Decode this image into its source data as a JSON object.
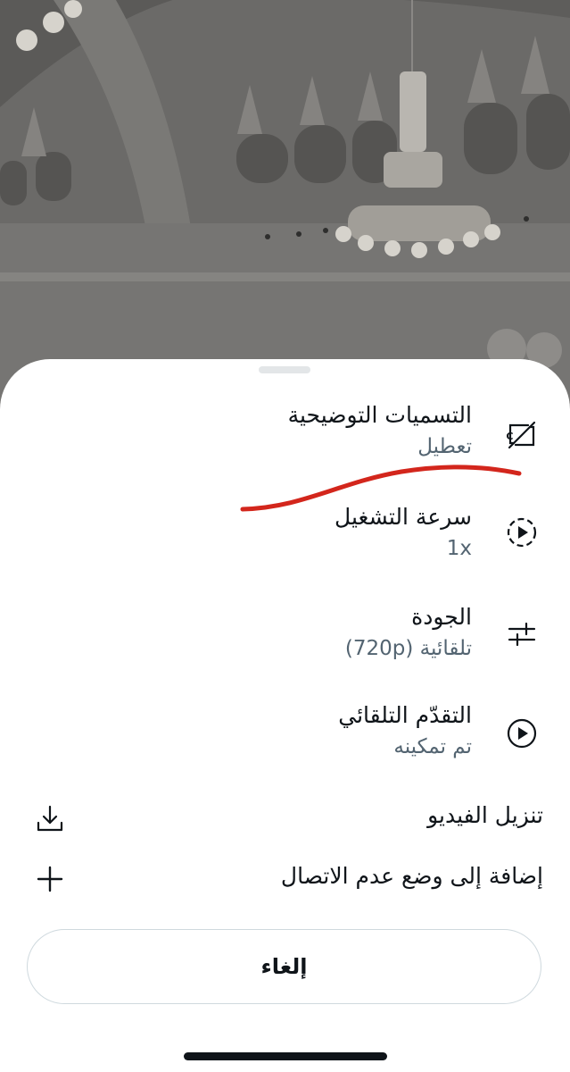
{
  "settings": [
    {
      "title": "التسميات التوضيحية",
      "value": "تعطيل",
      "icon": "captions-off-icon"
    },
    {
      "title": "سرعة التشغيل",
      "value": "1x",
      "icon": "playback-speed-icon"
    },
    {
      "title": "الجودة",
      "value": "تلقائية (720p)",
      "icon": "quality-sliders-icon"
    },
    {
      "title": "التقدّم التلقائي",
      "value": "تم تمكينه",
      "icon": "autoplay-icon"
    }
  ],
  "actions": {
    "download": {
      "label": "تنزيل الفيديو",
      "icon": "download-icon"
    },
    "offline": {
      "label": "إضافة إلى وضع عدم الاتصال",
      "icon": "plus-icon"
    }
  },
  "cancel_label": "إلغاء",
  "colors": {
    "primary_text": "#0f1419",
    "secondary_text": "#536471",
    "annotation": "#d3261c"
  }
}
